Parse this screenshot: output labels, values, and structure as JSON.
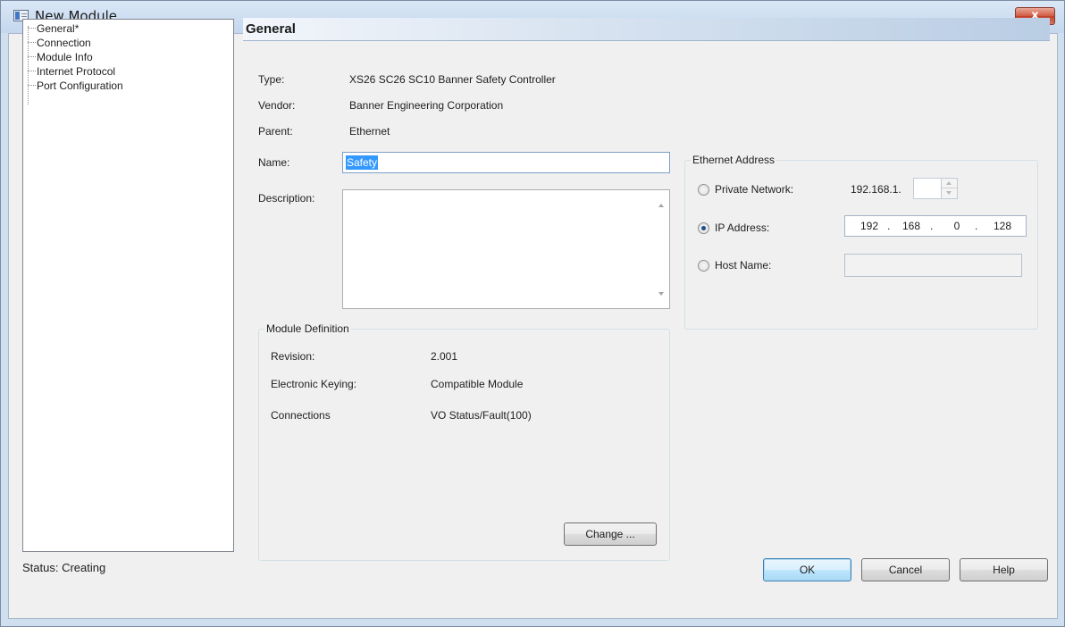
{
  "window": {
    "title": "New Module",
    "close_glyph": "x"
  },
  "tree": {
    "items": [
      {
        "label": "General*"
      },
      {
        "label": "Connection"
      },
      {
        "label": "Module Info"
      },
      {
        "label": "Internet Protocol"
      },
      {
        "label": "Port Configuration"
      }
    ]
  },
  "general": {
    "header": "General",
    "type_label": "Type:",
    "type_value": "XS26 SC26 SC10 Banner Safety Controller",
    "vendor_label": "Vendor:",
    "vendor_value": "Banner Engineering Corporation",
    "parent_label": "Parent:",
    "parent_value": "Ethernet",
    "name_label": "Name:",
    "name_value": "Safety",
    "description_label": "Description:",
    "description_value": ""
  },
  "module_definition": {
    "title": "Module Definition",
    "revision_label": "Revision:",
    "revision_value": "2.001",
    "keying_label": "Electronic Keying:",
    "keying_value": "Compatible Module",
    "connections_label": "Connections",
    "connections_value": "VO Status/Fault(100)",
    "change_button": "Change ..."
  },
  "ethernet_address": {
    "title": "Ethernet Address",
    "private_network_label": "Private Network:",
    "private_network_prefix": "192.168.1.",
    "private_network_value": "",
    "ip_address_label": "IP Address:",
    "ip_octets": [
      "192",
      "168",
      "0",
      "128"
    ],
    "host_name_label": "Host Name:",
    "host_name_value": "",
    "selected": "ip_address"
  },
  "status": {
    "text": "Status:  Creating"
  },
  "buttons": {
    "ok": "OK",
    "cancel": "Cancel",
    "help": "Help"
  }
}
